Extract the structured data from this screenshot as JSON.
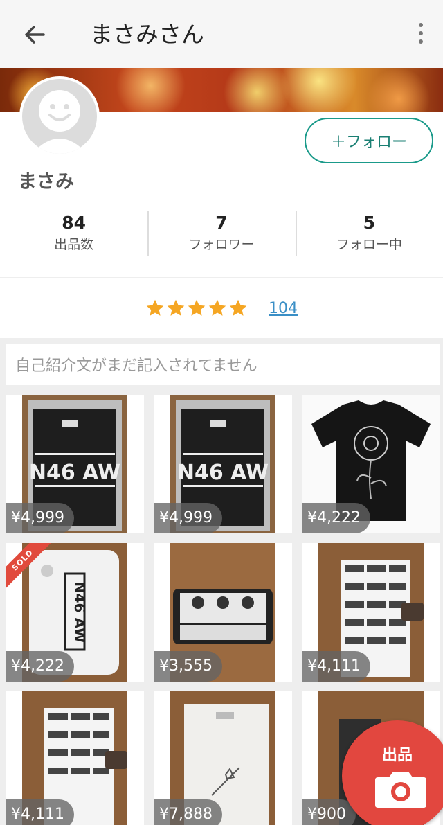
{
  "appbar": {
    "title": "まさみさん"
  },
  "profile": {
    "name": "まさみ",
    "follow_label": "＋フォロー",
    "stats": [
      {
        "value": "84",
        "label": "出品数"
      },
      {
        "value": "7",
        "label": "フォロワー"
      },
      {
        "value": "5",
        "label": "フォロー中"
      }
    ]
  },
  "rating": {
    "stars": 5,
    "count": "104"
  },
  "bio": {
    "placeholder": "自己紹介文がまだ記入されてません"
  },
  "items": [
    {
      "price": "¥4,999",
      "sold": false
    },
    {
      "price": "¥4,999",
      "sold": false
    },
    {
      "price": "¥4,222",
      "sold": false
    },
    {
      "price": "¥4,222",
      "sold": true,
      "sold_label": "SOLD"
    },
    {
      "price": "¥3,555",
      "sold": false
    },
    {
      "price": "¥4,111",
      "sold": false
    },
    {
      "price": "¥4,111",
      "sold": false
    },
    {
      "price": "¥7,888",
      "sold": false
    },
    {
      "price": "¥900",
      "sold": false
    }
  ],
  "fab": {
    "label": "出品"
  },
  "colors": {
    "accent": "#1a9a8a",
    "fab": "#e2473f",
    "star": "#f5a623",
    "link": "#3a8fc6"
  }
}
